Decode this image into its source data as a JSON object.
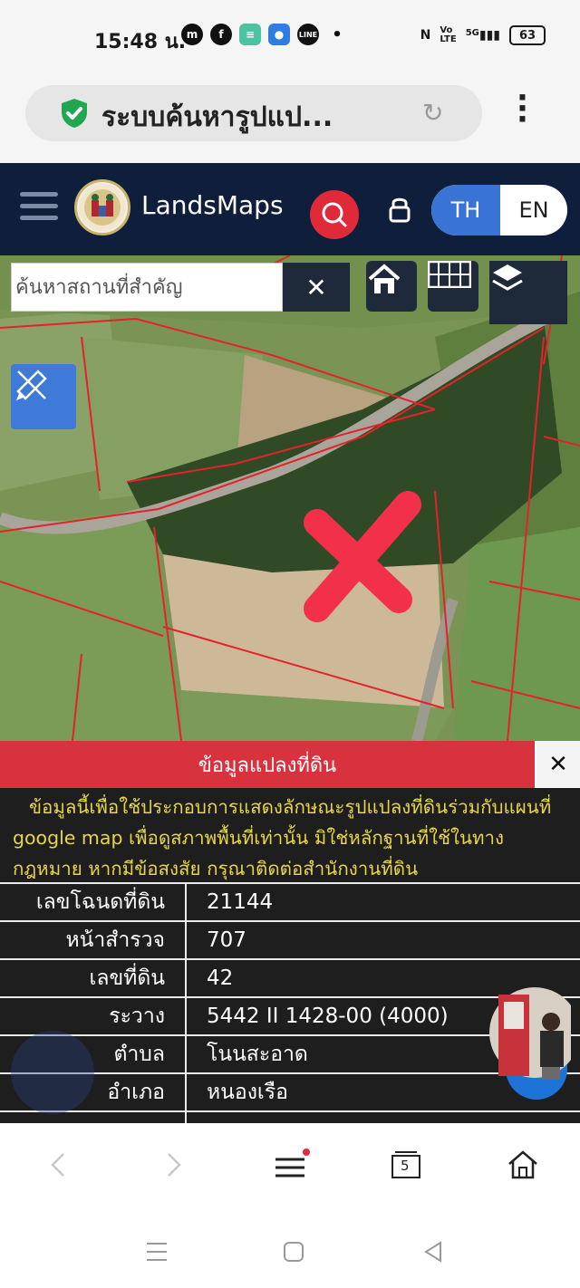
{
  "status_bar": {
    "time": "15:48 น.",
    "battery": "63",
    "network": "5G"
  },
  "browser": {
    "url_title": "ระบบค้นหารูปแป...",
    "tab_count": "5",
    "icons": [
      "shield-check-icon",
      "reload-icon",
      "more-vert-icon",
      "back-icon",
      "forward-icon",
      "menu-icon",
      "tabs-icon",
      "home-icon"
    ]
  },
  "app_header": {
    "brand": "LandsMaps",
    "lang_th": "TH",
    "lang_en": "EN",
    "colors": {
      "header_bg": "#0f1e3a",
      "search_accent": "#e02a3a",
      "lang_active": "#3a73d6"
    }
  },
  "map": {
    "search_placeholder": "ค้นหาสถานที่สำคัญ",
    "clear_symbol": "✕"
  },
  "parcel_panel": {
    "title": "ข้อมูลแปลงที่ดิน",
    "close_symbol": "✕",
    "notice": "ข้อมูลนี้เพื่อใช้ประกอบการแสดงลักษณะรูปแปลงที่ดินร่วมกับแผนที่ google map เพื่อดูสภาพพื้นที่เท่านั้น มิใช่หลักฐานที่ใช้ในทางกฎหมาย หากมีข้อสงสัย กรุณาติดต่อสำนักงานที่ดิน",
    "rows": [
      {
        "label": "เลขโฉนดที่ดิน",
        "value": "21144"
      },
      {
        "label": "หน้าสำรวจ",
        "value": "707"
      },
      {
        "label": "เลขที่ดิน",
        "value": "42"
      },
      {
        "label": "ระวาง",
        "value": "5442 II 1428-00 (4000)"
      },
      {
        "label": "ตำบล",
        "value": "โนนสะอาด"
      },
      {
        "label": "อำเภอ",
        "value": "หนองเรือ"
      }
    ],
    "colors": {
      "header_bg": "#d9323f",
      "notice_text": "#e8d64a",
      "table_bg": "#1e1e1e"
    }
  }
}
